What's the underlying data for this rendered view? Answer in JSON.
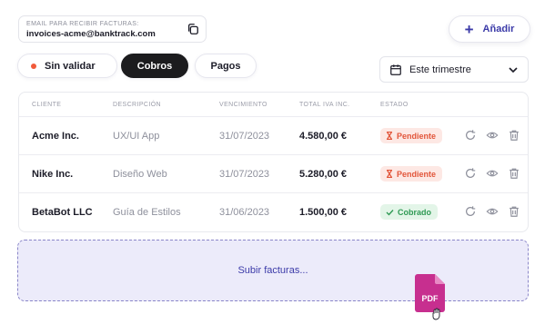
{
  "billing_email": {
    "label": "EMAIL PARA RECIBIR FACTURAS:",
    "value": "invoices-acme@banktrack.com",
    "copy_icon": "copy-icon"
  },
  "add_button": {
    "label": "Añadir",
    "icon": "plus-icon"
  },
  "tabs": [
    {
      "label": "Sin validar",
      "active": false,
      "indicator_color": "#f15a3a"
    },
    {
      "label": "Cobros",
      "active": true
    },
    {
      "label": "Pagos",
      "active": false
    }
  ],
  "period_select": {
    "value": "Este trimestre",
    "icon": "calendar-icon"
  },
  "table": {
    "columns": [
      "CLIENTE",
      "DESCRIPCIÓN",
      "VENCIMIENTO",
      "TOTAL IVA INC.",
      "ESTADO"
    ],
    "rows": [
      {
        "client": "Acme Inc.",
        "description": "UX/UI App",
        "due": "31/07/2023",
        "total": "4.580,00 €",
        "status": "Pendiente",
        "status_icon": "hourglass-icon"
      },
      {
        "client": "Nike Inc.",
        "description": "Diseño Web",
        "due": "31/07/2023",
        "total": "5.280,00 €",
        "status": "Pendiente",
        "status_icon": "hourglass-icon"
      },
      {
        "client": "BetaBot LLC",
        "description": "Guía de Estilos",
        "due": "31/06/2023",
        "total": "1.500,00 €",
        "status": "Cobrado",
        "status_icon": "check-icon"
      }
    ],
    "row_actions": [
      "refresh-icon",
      "eye-icon",
      "trash-icon"
    ]
  },
  "upload": {
    "label": "Subir facturas..."
  },
  "drag_file": {
    "label": "PDF",
    "color": "#c72f8f"
  },
  "colors": {
    "accent": "#3b3aa8",
    "pending": "#e2553a",
    "paid": "#2f9a54",
    "dark": "#1c1c1e"
  }
}
